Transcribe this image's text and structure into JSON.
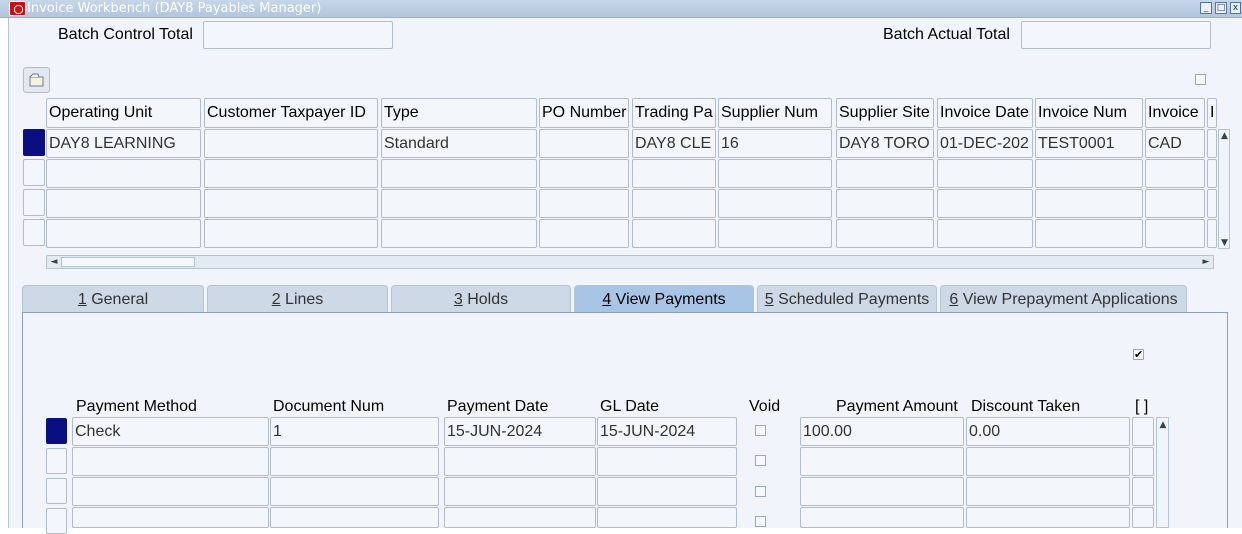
{
  "window": {
    "title": "Invoice Workbench (DAY8 Payables Manager)",
    "controls": [
      "_",
      "□",
      "x"
    ]
  },
  "batch": {
    "control_total_label": "Batch Control Total",
    "control_total_value": "",
    "actual_total_label": "Batch Actual Total",
    "actual_total_value": ""
  },
  "invoices": {
    "columns": [
      "Operating Unit",
      "Customer Taxpayer ID",
      "Type",
      "PO Number",
      "Trading Pa",
      "Supplier Num",
      "Supplier Site",
      "Invoice Date",
      "Invoice Num",
      "Invoice",
      "I"
    ],
    "rows": [
      [
        "DAY8 LEARNING",
        "",
        "Standard",
        "",
        "DAY8 CLE",
        "16",
        "DAY8 TORO",
        "01-DEC-202",
        "TEST0001",
        "CAD",
        ""
      ],
      [
        "",
        "",
        "",
        "",
        "",
        "",
        "",
        "",
        "",
        "",
        ""
      ],
      [
        "",
        "",
        "",
        "",
        "",
        "",
        "",
        "",
        "",
        "",
        ""
      ],
      [
        "",
        "",
        "",
        "",
        "",
        "",
        "",
        "",
        "",
        "",
        ""
      ]
    ]
  },
  "tabs": [
    {
      "num": "1",
      "label": " General",
      "active": false
    },
    {
      "num": "2",
      "label": " Lines",
      "active": false
    },
    {
      "num": "3",
      "label": " Holds",
      "active": false
    },
    {
      "num": "4",
      "label": " View Payments",
      "active": true
    },
    {
      "num": "5",
      "label": " Scheduled Payments",
      "active": false
    },
    {
      "num": "6",
      "label": " View Prepayment Applications",
      "active": false
    }
  ],
  "payments": {
    "columns": {
      "method": "Payment Method",
      "doc_num": "Document Num",
      "pay_date": "Payment Date",
      "gl_date": "GL Date",
      "void": "Void",
      "amount": "Payment Amount",
      "discount": "Discount Taken",
      "flex": "[ ]"
    },
    "rows": [
      {
        "method": "Check",
        "doc_num": "1",
        "pay_date": "15-JUN-2024",
        "gl_date": "15-JUN-2024",
        "void": false,
        "amount": "100.00",
        "discount": "0.00"
      },
      {
        "method": "",
        "doc_num": "",
        "pay_date": "",
        "gl_date": "",
        "void": false,
        "amount": "",
        "discount": ""
      },
      {
        "method": "",
        "doc_num": "",
        "pay_date": "",
        "gl_date": "",
        "void": false,
        "amount": "",
        "discount": ""
      },
      {
        "method": "",
        "doc_num": "",
        "pay_date": "",
        "gl_date": "",
        "void": false,
        "amount": "",
        "discount": ""
      }
    ]
  },
  "colors": {
    "titlebar": "#b7cae0",
    "current_record": "#0a0e80",
    "active_tab": "#a9c5e6",
    "oracle_red": "#cc1010"
  },
  "icons": {
    "folder": "folder-icon",
    "checkmark": "✔"
  }
}
